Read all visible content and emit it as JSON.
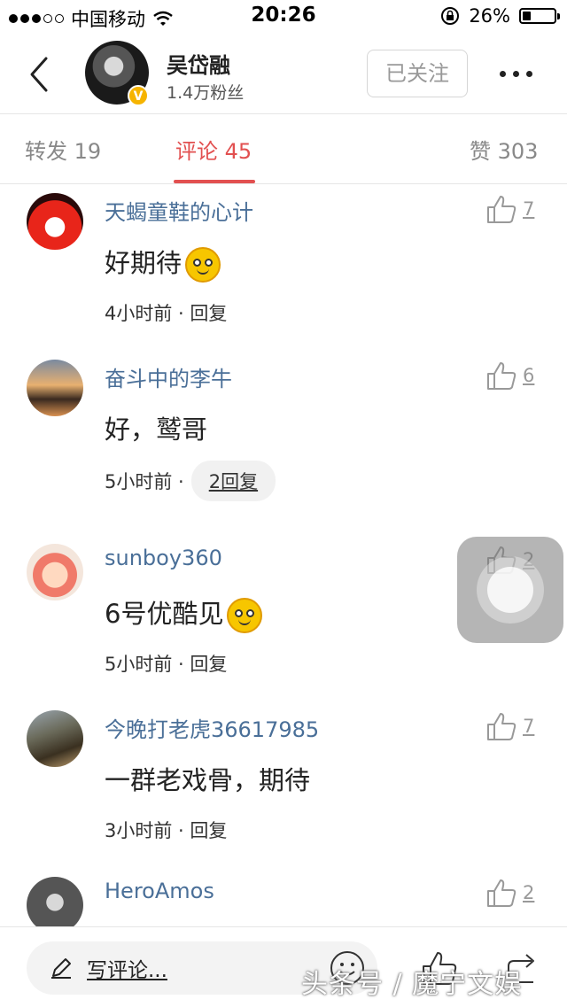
{
  "status_bar": {
    "carrier": "中国移动",
    "time": "20:26",
    "battery": "26%",
    "battery_level": 0.26,
    "signal_filled": 3,
    "signal_total": 5
  },
  "header": {
    "name": "吴岱融",
    "fans": "1.4万粉丝",
    "follow_label": "已关注",
    "verified_badge": "V"
  },
  "tabs": {
    "repost": "转发 19",
    "comments": "评论 45",
    "likes": "赞 303"
  },
  "comments": [
    {
      "user": "天蝎童鞋的心计",
      "text": "好期待",
      "emoji": "smile-emoji",
      "time": "4小时前 · 回复",
      "likes": "7"
    },
    {
      "user": "奋斗中的李牛",
      "text": "好，鹫哥",
      "time": "5小时前 ·",
      "reply_label": "2回复",
      "likes": "6"
    },
    {
      "user": "sunboy360",
      "text": "6号优酷见",
      "emoji": "grin-emoji",
      "time": "5小时前 · 回复",
      "likes": "2"
    },
    {
      "user": "今晚打老虎36617985",
      "text": "一群老戏骨，期待",
      "time": "3小时前 · 回复",
      "likes": "7"
    },
    {
      "user": "HeroAmos",
      "text": "",
      "likes": "2"
    }
  ],
  "bottom_bar": {
    "write_label": "写评论..."
  },
  "watermark": "头条号 / 魔宁文娱",
  "colors": {
    "accent": "#e25050",
    "username": "#4a6f98",
    "verified": "#f6b400"
  }
}
